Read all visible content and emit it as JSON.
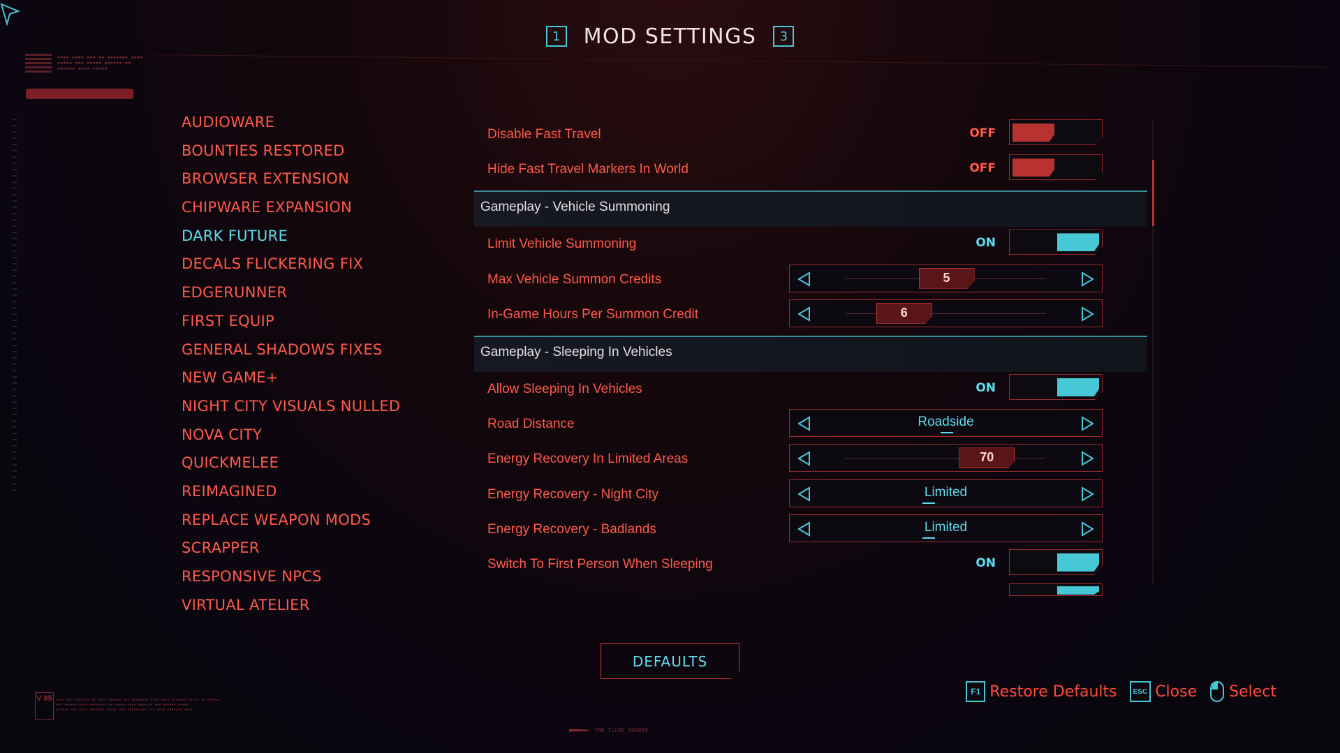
{
  "header": {
    "title": "MOD SETTINGS",
    "prev_key": "1",
    "next_key": "3"
  },
  "mods": [
    {
      "label": "AUDIOWARE",
      "active": false
    },
    {
      "label": "BOUNTIES RESTORED",
      "active": false
    },
    {
      "label": "BROWSER EXTENSION",
      "active": false
    },
    {
      "label": "CHIPWARE EXPANSION",
      "active": false
    },
    {
      "label": "DARK FUTURE",
      "active": true
    },
    {
      "label": "DECALS FLICKERING FIX",
      "active": false
    },
    {
      "label": "EDGERUNNER",
      "active": false
    },
    {
      "label": "FIRST EQUIP",
      "active": false
    },
    {
      "label": "GENERAL SHADOWS FIXES",
      "active": false
    },
    {
      "label": "NEW GAME+",
      "active": false
    },
    {
      "label": "NIGHT CITY VISUALS NULLED",
      "active": false
    },
    {
      "label": "NOVA CITY",
      "active": false
    },
    {
      "label": "QUICKMELEE",
      "active": false
    },
    {
      "label": "REIMAGINED",
      "active": false
    },
    {
      "label": "REPLACE WEAPON MODS",
      "active": false
    },
    {
      "label": "SCRAPPER",
      "active": false
    },
    {
      "label": "RESPONSIVE NPCS",
      "active": false
    },
    {
      "label": "VIRTUAL ATELIER",
      "active": false
    }
  ],
  "settings": {
    "disable_fast_travel": {
      "label": "Disable Fast Travel",
      "state": "OFF"
    },
    "hide_fast_travel_markers": {
      "label": "Hide Fast Travel Markers In World",
      "state": "OFF"
    },
    "section_vehicle_summoning": "Gameplay - Vehicle Summoning",
    "limit_vehicle_summoning": {
      "label": "Limit Vehicle Summoning",
      "state": "ON"
    },
    "max_vehicle_summon_credits": {
      "label": "Max Vehicle Summon Credits",
      "value": "5",
      "fraction": 0.5
    },
    "hours_per_summon_credit": {
      "label": "In-Game Hours Per Summon Credit",
      "value": "6",
      "fraction": 0.29
    },
    "section_sleeping_in_vehicles": "Gameplay - Sleeping In Vehicles",
    "allow_sleeping_in_vehicles": {
      "label": "Allow Sleeping In Vehicles",
      "state": "ON"
    },
    "road_distance": {
      "label": "Road Distance",
      "value": "Roadside"
    },
    "energy_recovery_limited_areas": {
      "label": "Energy Recovery In Limited Areas",
      "value": "70",
      "fraction": 0.7
    },
    "energy_recovery_night_city": {
      "label": "Energy Recovery - Night City",
      "value": "Limited"
    },
    "energy_recovery_badlands": {
      "label": "Energy Recovery - Badlands",
      "value": "Limited"
    },
    "switch_first_person_sleeping": {
      "label": "Switch To First Person When Sleeping",
      "state": "ON"
    }
  },
  "scroll": {
    "position": 0.1
  },
  "defaults_button": "DEFAULTS",
  "hints": {
    "restore_key": "F1",
    "restore_label": "Restore Defaults",
    "close_key": "ESC",
    "close_label": "Close",
    "select_label": "Select"
  },
  "version_badge": "V 85",
  "bottom_code": "TRN_TLCAS_800095",
  "colors": {
    "accent_cyan": "#5fdcec",
    "accent_red": "#ff5a4a",
    "toggle_off": "#b8332f"
  }
}
